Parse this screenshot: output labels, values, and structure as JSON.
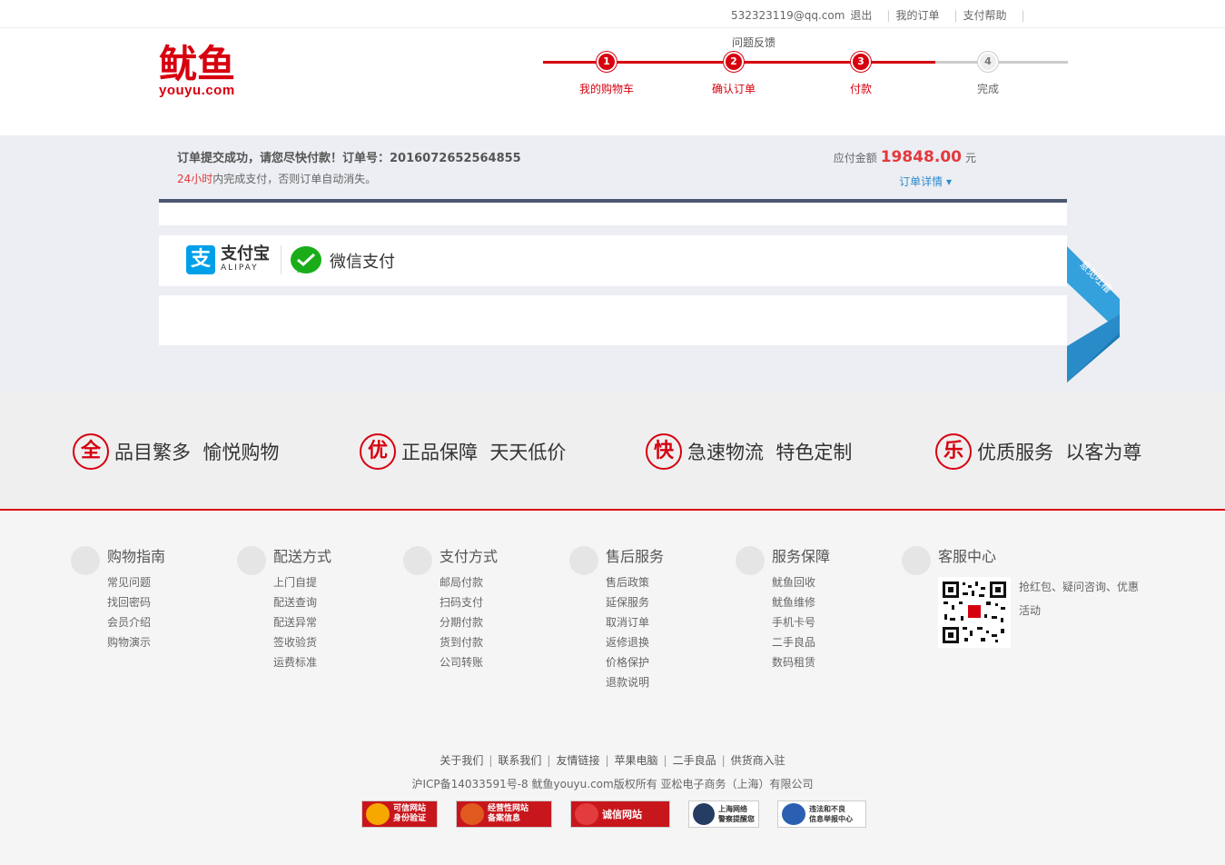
{
  "topbar": {
    "email": "532323119@qq.com",
    "logout": "退出",
    "my_orders": "我的订单",
    "pay_help": "支付帮助",
    "sep": "|"
  },
  "header": {
    "logo_cn": "鱿鱼",
    "logo_en": "youyu.com",
    "feedback": "问题反馈",
    "steps": [
      {
        "num": "1",
        "label": "我的购物车",
        "state": "active"
      },
      {
        "num": "2",
        "label": "确认订单",
        "state": "active"
      },
      {
        "num": "3",
        "label": "付款",
        "state": "active"
      },
      {
        "num": "4",
        "label": "完成",
        "state": "todo"
      }
    ]
  },
  "order": {
    "title": "订单提交成功，请您尽快付款！订单号：2016072652564855",
    "notice_highlight": "24小时",
    "notice_rest": "内完成支付，否则订单自动消失。",
    "amount_label": "应付金额",
    "amount": "19848.00",
    "currency": "元",
    "detail_link": "订单详情 ▾"
  },
  "payment": {
    "alipay_icon": "支",
    "alipay_cn": "支付宝",
    "alipay_en": "ALIPAY",
    "wechat_label": "微信支付",
    "ribbon_text": "意见吐槽"
  },
  "features": [
    {
      "icon": "全",
      "text": "品目繁多  愉悦购物"
    },
    {
      "icon": "优",
      "text": "正品保障  天天低价"
    },
    {
      "icon": "快",
      "text": "急速物流  特色定制"
    },
    {
      "icon": "乐",
      "text": "优质服务  以客为尊"
    }
  ],
  "footer_columns": [
    {
      "title": "购物指南",
      "items": [
        "常见问题",
        "找回密码",
        "会员介绍",
        "购物演示"
      ]
    },
    {
      "title": "配送方式",
      "items": [
        "上门自提",
        "配送查询",
        "配送异常",
        "签收验货",
        "运费标准"
      ]
    },
    {
      "title": "支付方式",
      "items": [
        "邮局付款",
        "扫码支付",
        "分期付款",
        "货到付款",
        "公司转账"
      ]
    },
    {
      "title": "售后服务",
      "items": [
        "售后政策",
        "延保服务",
        "取消订单",
        "返修退换",
        "价格保护",
        "退款说明"
      ]
    },
    {
      "title": "服务保障",
      "items": [
        "鱿鱼回收",
        "鱿鱼维修",
        "手机卡号",
        "二手良品",
        "数码租赁"
      ]
    }
  ],
  "service_center": {
    "title": "客服中心",
    "text": "抢红包、疑问咨询、优惠活动"
  },
  "bottom": {
    "links": [
      "关于我们",
      "联系我们",
      "友情链接",
      "苹果电脑",
      "二手良品",
      "供货商入驻"
    ],
    "icp": "沪ICP备14033591号-8 鱿鱼youyu.com版权所有 亚松电子商务（上海）有限公司",
    "badges": [
      {
        "text": "可信网站\n身份验证",
        "color": "#c8161d"
      },
      {
        "text": "经营性网站\n备案信息",
        "color": "#c8161d"
      },
      {
        "text": "诚信网站",
        "color": "#c8161d"
      },
      {
        "text": "上海网络\n警察提醒您",
        "color": "#ffffff"
      },
      {
        "text": "违法和不良\n信息举报中心",
        "color": "#ffffff"
      }
    ]
  }
}
